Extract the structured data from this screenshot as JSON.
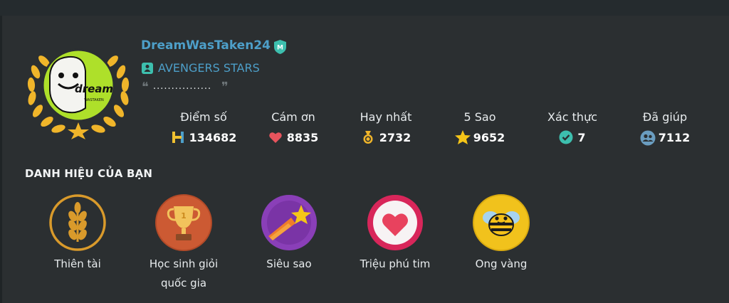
{
  "profile": {
    "username": "DreamWasTaken24",
    "mod_badge_letter": "M",
    "team": "AVENGERS STARS",
    "quote_open": "❝",
    "quote": "................",
    "quote_close": "❞",
    "avatar_text": "dream",
    "avatar_subtext": "WASTAKEN"
  },
  "stats": [
    {
      "label": "Điểm số",
      "value": "134682",
      "icon": "points-icon"
    },
    {
      "label": "Cám ơn",
      "value": "8835",
      "icon": "heart-icon"
    },
    {
      "label": "Hay nhất",
      "value": "2732",
      "icon": "medal-icon"
    },
    {
      "label": "5 Sao",
      "value": "9652",
      "icon": "star-icon"
    },
    {
      "label": "Xác thực",
      "value": "7",
      "icon": "verified-icon"
    },
    {
      "label": "Đã giúp",
      "value": "7112",
      "icon": "helped-users-icon"
    }
  ],
  "titles_section": {
    "heading": "DANH HIỆU CỦA BẠN",
    "badges": [
      {
        "label": "Thiên tài",
        "icon": "wheat-icon"
      },
      {
        "label": "Học sinh giỏi quốc gia",
        "icon": "trophy-icon"
      },
      {
        "label": "Siêu sao",
        "icon": "shooting-star-icon"
      },
      {
        "label": "Triệu phú tim",
        "icon": "heart-coin-icon"
      },
      {
        "label": "Ong vàng",
        "icon": "bee-icon"
      }
    ]
  },
  "colors": {
    "background": "#2b2f31",
    "accent_blue": "#4d9fc9",
    "teal": "#3dbfae",
    "gold": "#f0b52a"
  }
}
